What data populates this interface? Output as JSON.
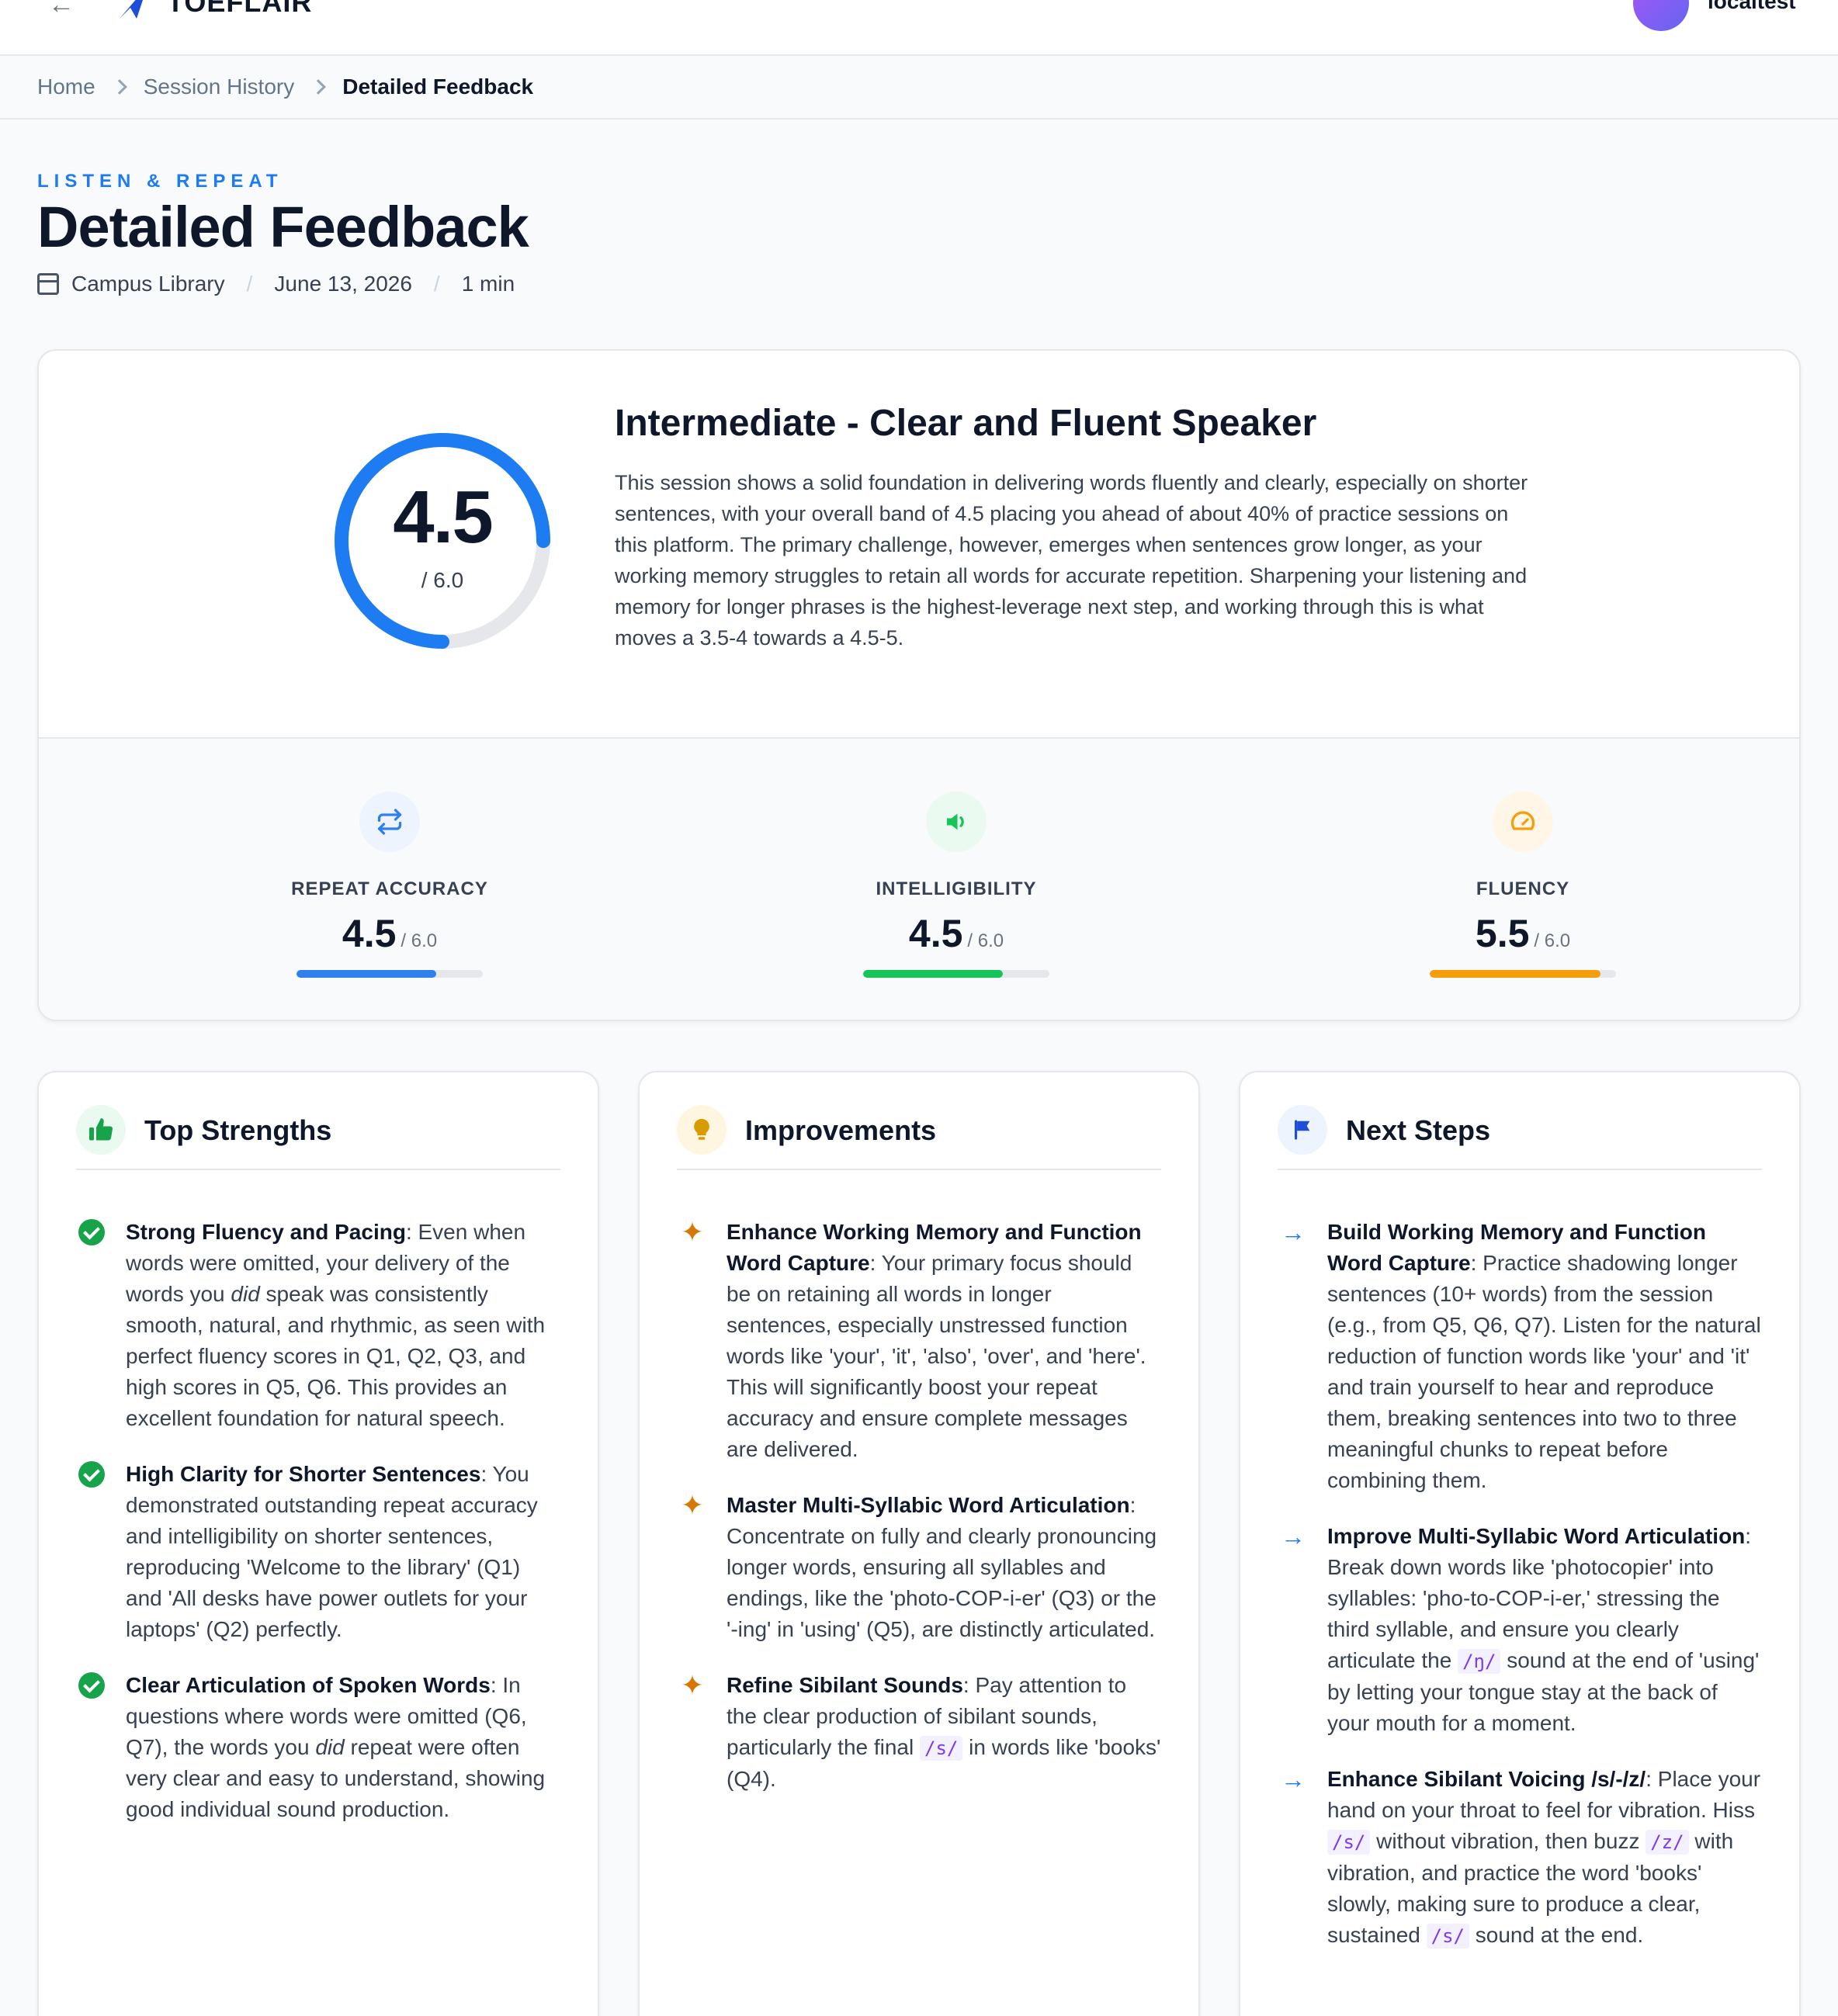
{
  "app": {
    "name": "TOEFLAIR",
    "username": "localtest"
  },
  "breadcrumb": [
    "Home",
    "Session History",
    "Detailed Feedback"
  ],
  "header": {
    "eyebrow": "LISTEN & REPEAT",
    "title": "Detailed Feedback",
    "location": "Campus Library",
    "date": "June 13, 2026",
    "duration": "1 min"
  },
  "summary": {
    "score": "4.5",
    "max": "/ 6.0",
    "score_value": 4.5,
    "score_max_value": 6.0,
    "title": "Intermediate - Clear and Fluent Speaker",
    "text": "This session shows a solid foundation in delivering words fluently and clearly, especially on shorter sentences, with your overall band of 4.5 placing you ahead of about 40% of practice sessions on this platform. The primary challenge, however, emerges when sentences grow longer, as your working memory struggles to retain all words for accurate repetition. Sharpening your listening and memory for longer phrases is the highest-leverage next step, and working through this is what moves a 3.5-4 towards a 4.5-5."
  },
  "metrics": [
    {
      "label": "REPEAT ACCURACY",
      "score": "4.5",
      "max": "/ 6.0",
      "value": 4.5,
      "max_value": 6.0,
      "icon": "repeat-icon",
      "color": "#2f80ed",
      "icon_bg": "#eef4fe"
    },
    {
      "label": "INTELLIGIBILITY",
      "score": "4.5",
      "max": "/ 6.0",
      "value": 4.5,
      "max_value": 6.0,
      "icon": "volume-icon",
      "color": "#16c45a",
      "icon_bg": "#eafaf0"
    },
    {
      "label": "FLUENCY",
      "score": "5.5",
      "max": "/ 6.0",
      "value": 5.5,
      "max_value": 6.0,
      "icon": "speedometer-icon",
      "color": "#f59e0b",
      "icon_bg": "#fff6e8"
    }
  ],
  "cards": {
    "strengths": {
      "title": "Top Strengths",
      "icon": "thumbs-up-icon",
      "items": [
        {
          "title": "Strong Fluency and Pacing",
          "p1": ": Even when words were omitted, your delivery of the words you ",
          "em": "did",
          "p2": " speak was consistently smooth, natural, and rhythmic, as seen with perfect fluency scores in Q1, Q2, Q3, and high scores in Q5, Q6. This provides an excellent foundation for natural speech."
        },
        {
          "title": "High Clarity for Shorter Sentences",
          "p1": ": You demonstrated outstanding repeat accuracy and intelligibility on shorter sentences, reproducing 'Welcome to the library' (Q1) and 'All desks have power outlets for your laptops' (Q2) perfectly."
        },
        {
          "title": "Clear Articulation of Spoken Words",
          "p1": ": In questions where words were omitted (Q6, Q7), the words you ",
          "em": "did",
          "p2": " repeat were often very clear and easy to understand, showing good individual sound production."
        }
      ]
    },
    "improvements": {
      "title": "Improvements",
      "icon": "lightbulb-icon",
      "items": [
        {
          "title": "Enhance Working Memory and Function Word Capture",
          "p1": ": Your primary focus should be on retaining all words in longer sentences, especially unstressed function words like 'your', 'it', 'also', 'over', and 'here'. This will significantly boost your repeat accuracy and ensure complete messages are delivered."
        },
        {
          "title": "Master Multi-Syllabic Word Articulation",
          "p1": ": Concentrate on fully and clearly pronouncing longer words, ensuring all syllables and endings, like the 'photo-COP-i-er' (Q3) or the '-ing' in 'using' (Q5), are distinctly articulated."
        },
        {
          "title": "Refine Sibilant Sounds",
          "p1": ": Pay attention to the clear production of sibilant sounds, particularly the final ",
          "ipa1": "/s/",
          "p2": " in words like 'books' (Q4)."
        }
      ]
    },
    "next_steps": {
      "title": "Next Steps",
      "icon": "flag-icon",
      "items": [
        {
          "title": "Build Working Memory and Function Word Capture",
          "p1": ": Practice shadowing longer sentences (10+ words) from the session (e.g., from Q5, Q6, Q7). Listen for the natural reduction of function words like 'your' and 'it' and train yourself to hear and reproduce them, breaking sentences into two to three meaningful chunks to repeat before combining them."
        },
        {
          "title": "Improve Multi-Syllabic Word Articulation",
          "p1": ": Break down words like 'photocopier' into syllables: 'pho-to-COP-i-er,' stressing the third syllable, and ensure you clearly articulate the ",
          "ipa1": "/ŋ/",
          "p2": " sound at the end of 'using' by letting your tongue stay at the back of your mouth for a moment."
        },
        {
          "title": "Enhance Sibilant Voicing /s/-/z/",
          "p1": ": Place your hand on your throat to feel for vibration. Hiss ",
          "ipa1": "/s/",
          "p2": " without vibration, then buzz ",
          "ipa2": "/z/",
          "p3": " with vibration, and practice the word 'books' slowly, making sure to produce a clear, sustained ",
          "ipa3": "/s/",
          "p4": " sound at the end."
        }
      ]
    }
  }
}
